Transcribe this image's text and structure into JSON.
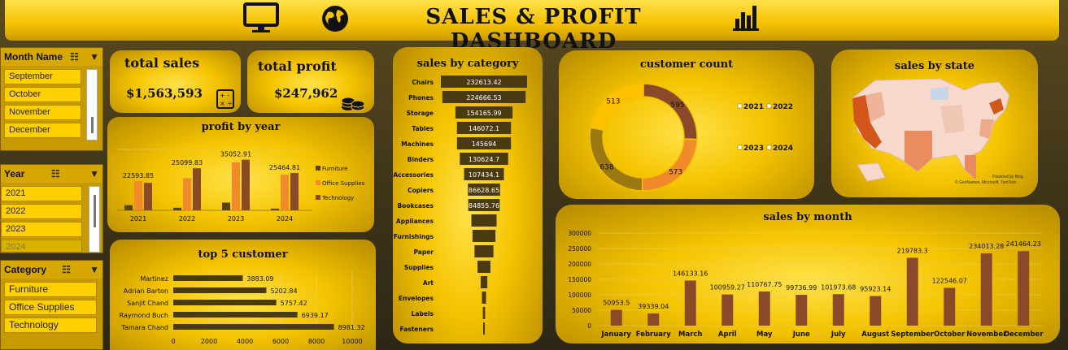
{
  "header": {
    "title": "SALES & PROFIT DASHBOARD",
    "icons": [
      "monitor-icon",
      "globe-icon",
      "bar-chart-icon"
    ]
  },
  "slicers": {
    "month": {
      "label": "Month Name",
      "items": [
        "September",
        "October",
        "November",
        "December"
      ]
    },
    "year": {
      "label": "Year",
      "items": [
        "2021",
        "2022",
        "2023",
        "2024"
      ],
      "inactive": [
        "2024"
      ]
    },
    "category": {
      "label": "Category",
      "items": [
        "Furniture",
        "Office Supplies",
        "Technology"
      ]
    }
  },
  "kpis": {
    "total_sales_label": "total sales",
    "total_sales_value": "$1,563,593",
    "total_profit_label": "total profit",
    "total_profit_value": "$247,962"
  },
  "panels": {
    "profit_by_year": "profit by year",
    "top5": "top 5 customer",
    "sales_by_category": "sales by category",
    "customer_count": "customer count",
    "sales_by_state": "sales by state",
    "sales_by_month": "sales by month",
    "map_credit_1": "Powered by Bing",
    "map_credit_2": "© GeoNames, Microsoft, TomTom"
  },
  "colors": {
    "furniture": "#5a4210",
    "office": "#f08a2a",
    "technology": "#8a4a28",
    "bar_dark": "#4a3a10",
    "month_bar": "#8a4a2a"
  },
  "chart_data": [
    {
      "type": "bar",
      "title": "profit by year",
      "categories": [
        "2021",
        "2022",
        "2023",
        "2024"
      ],
      "series": [
        {
          "name": "Furniture",
          "values": [
            1200,
            600,
            1800,
            400
          ]
        },
        {
          "name": "Office Supplies",
          "values": [
            6800,
            7500,
            11200,
            8300
          ]
        },
        {
          "name": "Technology",
          "values": [
            6400,
            9800,
            11800,
            8700
          ]
        }
      ],
      "labels": [
        "22593.85",
        "25099.83",
        "35052.91",
        "25464.81"
      ],
      "ylim": [
        0,
        14000
      ]
    },
    {
      "type": "bar",
      "title": "top 5 customer",
      "orientation": "horizontal",
      "categories": [
        "Martinez",
        "Adrian Barton",
        "Sanjit Chand",
        "Raymond Buch",
        "Tamara Chand"
      ],
      "values": [
        3883.09,
        5202.84,
        5757.42,
        6939.17,
        8981.32
      ],
      "xticks": [
        "0",
        "2000",
        "4000",
        "6000",
        "8000",
        "10000"
      ],
      "xlim": [
        0,
        10000
      ]
    },
    {
      "type": "bar",
      "title": "sales by category",
      "orientation": "horizontal",
      "categories": [
        "Chairs",
        "Phones",
        "Storage",
        "Tables",
        "Machines",
        "Binders",
        "Accessories",
        "Copiers",
        "Bookcases",
        "Appliances",
        "Furnishings",
        "Paper",
        "Supplies",
        "Art",
        "Envelopes",
        "Labels",
        "Fasteners"
      ],
      "values": [
        232613.42,
        224666.53,
        154165.99,
        146072.1,
        145694,
        130624.7,
        107434.1,
        86628.65,
        84855.76,
        68000,
        62000,
        51000,
        35000,
        18000,
        11000,
        6000,
        2000
      ],
      "labels": [
        "232613.42",
        "224666.53",
        "154165.99",
        "146072.1",
        "145694",
        "130624.7",
        "107434.1",
        "86628.65",
        "84855.76",
        "",
        "",
        "",
        "",
        "",
        "",
        "",
        ""
      ]
    },
    {
      "type": "pie",
      "title": "customer count",
      "categories": [
        "2021",
        "2022",
        "2023",
        "2024"
      ],
      "values": [
        595,
        573,
        638,
        513
      ],
      "labels": [
        "595",
        "573",
        "638",
        "513"
      ],
      "colors": [
        "#8a4a2a",
        "#f08a2a",
        "#9a7a10",
        "#ffc000"
      ],
      "legend": "right"
    },
    {
      "type": "bar",
      "title": "sales by month",
      "categories": [
        "January",
        "February",
        "March",
        "April",
        "May",
        "June",
        "July",
        "August",
        "September",
        "October",
        "November",
        "December"
      ],
      "values": [
        50953.5,
        39339.04,
        146133.16,
        100959.27,
        110767.75,
        99736.99,
        101973.68,
        95923.14,
        219783.3,
        122546.07,
        234013.28,
        241464.23
      ],
      "labels": [
        "50953.5",
        "39339.04",
        "146133.16",
        "100959.27",
        "110767.75",
        "99736.99",
        "101973.68",
        "95923.14",
        "219783.3",
        "122546.07",
        "234013.28",
        "241464.23"
      ],
      "yticks": [
        "0",
        "50000",
        "100000",
        "150000",
        "200000",
        "250000",
        "300000"
      ],
      "ylim": [
        0,
        300000
      ]
    }
  ]
}
